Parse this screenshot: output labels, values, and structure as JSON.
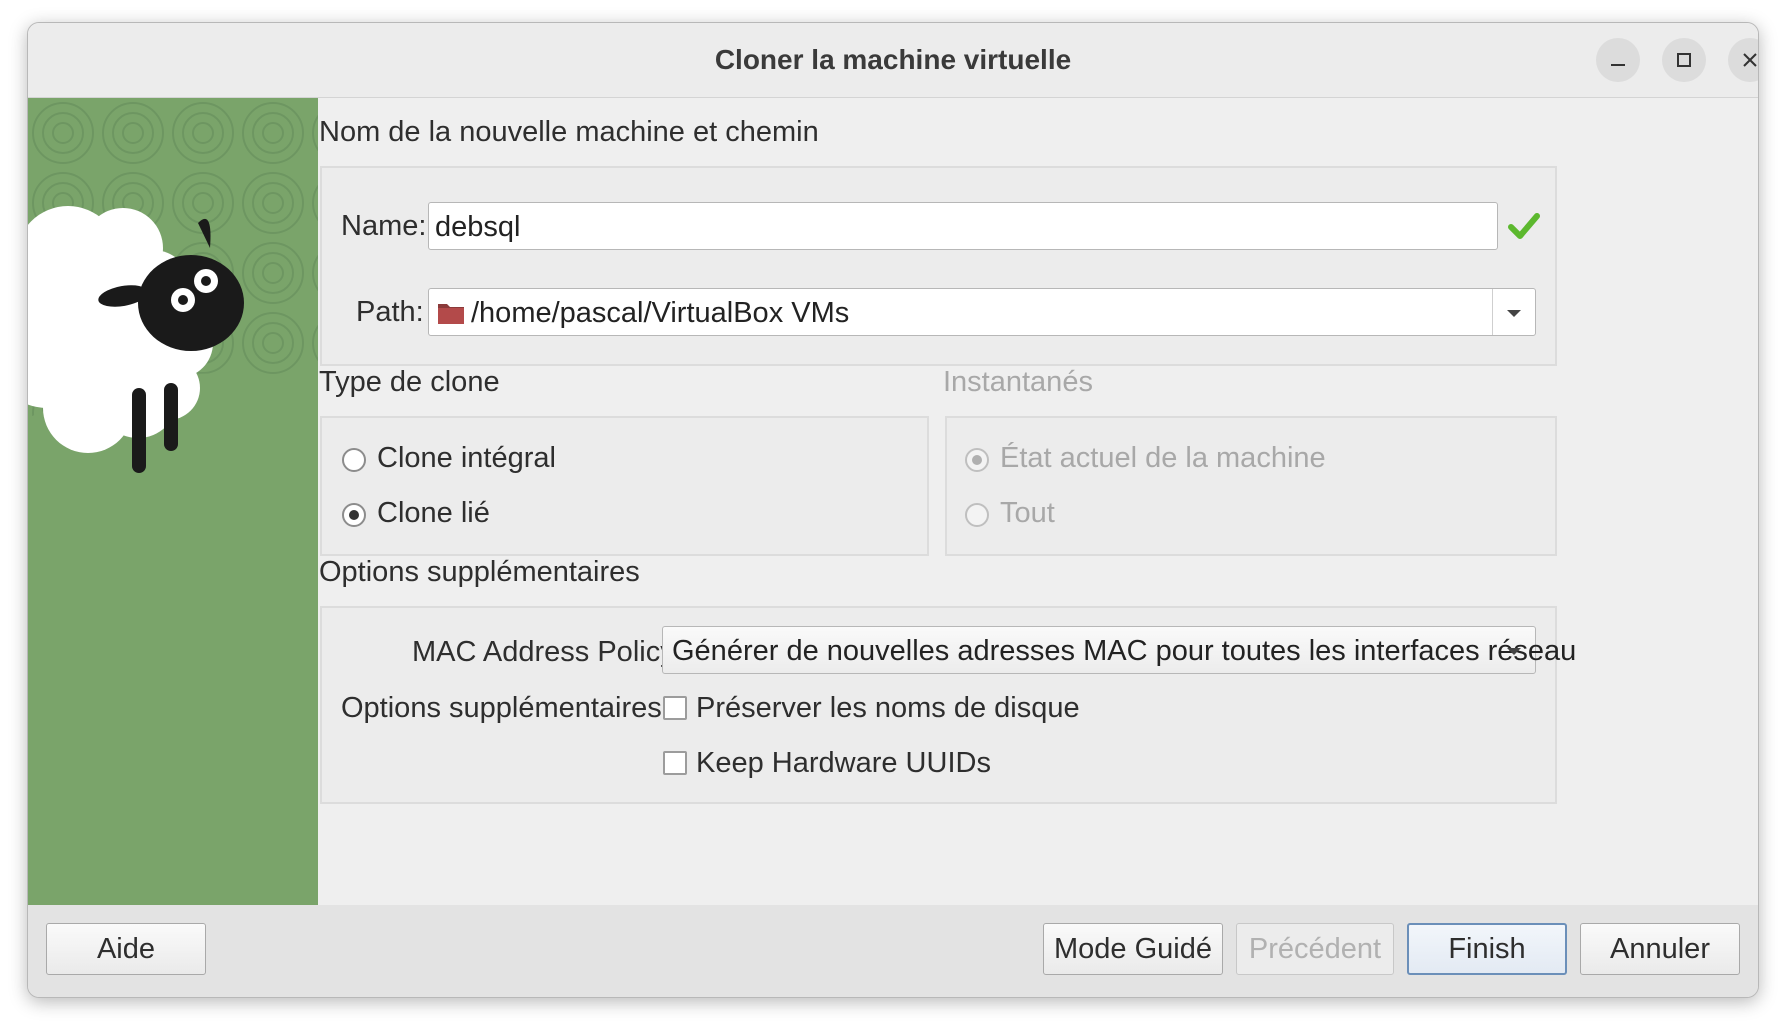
{
  "window": {
    "title": "Cloner la machine virtuelle",
    "controls": [
      "minimize-icon",
      "maximize-icon",
      "close-icon"
    ]
  },
  "name_path": {
    "section_title": "Nom de la nouvelle machine et chemin",
    "name_label": "Name:",
    "name_value": "debsql",
    "name_valid_icon": "checkmark-icon",
    "path_label": "Path:",
    "path_value": "/home/pascal/VirtualBox VMs",
    "path_icon": "folder-icon"
  },
  "clone_type": {
    "section_title": "Type de clone",
    "options": [
      {
        "label": "Clone intégral",
        "checked": false
      },
      {
        "label": "Clone lié",
        "checked": true
      }
    ]
  },
  "snapshots": {
    "section_title": "Instantanés",
    "enabled": false,
    "options": [
      {
        "label": "État actuel de la machine",
        "checked": true
      },
      {
        "label": "Tout",
        "checked": false
      }
    ]
  },
  "extra": {
    "section_title": "Options supplémentaires",
    "mac_label": "MAC Address Policy:",
    "mac_value": "Générer de nouvelles adresses MAC pour toutes les interfaces réseau",
    "options_label": "Options supplémentaires :",
    "checkboxes": [
      {
        "label": "Préserver les noms de disque",
        "checked": false
      },
      {
        "label": "Keep Hardware UUIDs",
        "checked": false
      }
    ]
  },
  "buttons": {
    "help": "Aide",
    "guided": "Mode Guidé",
    "back": "Précédent",
    "finish": "Finish",
    "cancel": "Annuler"
  },
  "colors": {
    "sidebar_green": "#7aa46a",
    "valid_green": "#5cb82e",
    "default_button_border": "#6b8fb9"
  }
}
